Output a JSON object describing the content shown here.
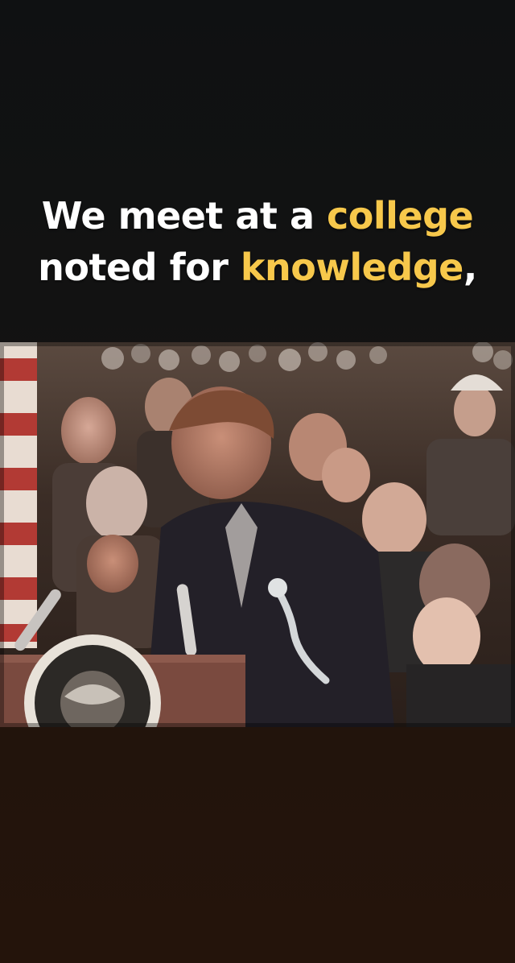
{
  "caption": {
    "line1_part1": "We meet at a ",
    "line1_highlight": "college",
    "line2_part1": "noted for ",
    "line2_highlight": "knowledge",
    "line2_part2": ","
  },
  "colors": {
    "accent": "#f7c84b",
    "text": "#ffffff",
    "background": "#121212"
  },
  "video": {
    "seal_icon": "presidential-seal-icon",
    "flag_icon": "american-flag-icon"
  }
}
